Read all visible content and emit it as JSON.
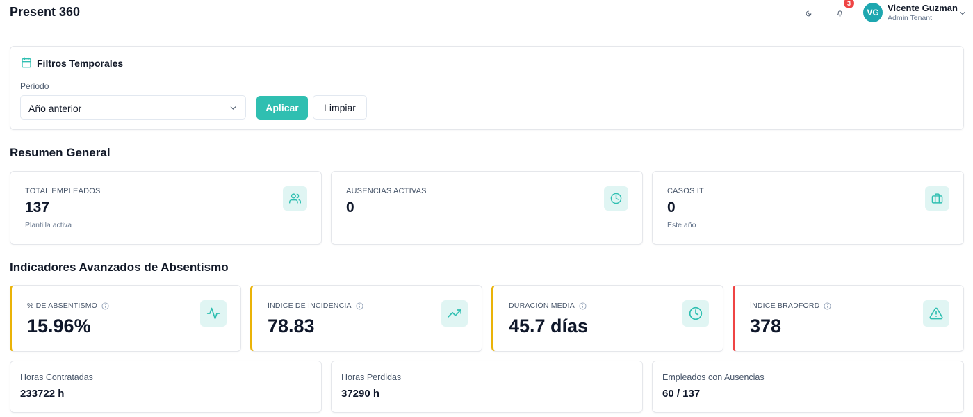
{
  "header": {
    "app_title": "Present 360",
    "notification_count": "3",
    "user": {
      "initials": "VG",
      "name": "Vicente Guzman",
      "role": "Admin Tenant"
    }
  },
  "filters": {
    "title": "Filtros Temporales",
    "period_label": "Periodo",
    "period_value": "Año anterior",
    "apply_label": "Aplicar",
    "clear_label": "Limpiar"
  },
  "summary": {
    "title": "Resumen General",
    "cards": [
      {
        "label": "TOTAL EMPLEADOS",
        "value": "137",
        "sub": "Plantilla activa",
        "icon": "users-icon"
      },
      {
        "label": "AUSENCIAS ACTIVAS",
        "value": "0",
        "sub": "",
        "icon": "clock-icon"
      },
      {
        "label": "CASOS IT",
        "value": "0",
        "sub": "Este año",
        "icon": "briefcase-icon"
      }
    ]
  },
  "indicators": {
    "title": "Indicadores Avanzados de Absentismo",
    "cards": [
      {
        "label": "% DE ABSENTISMO",
        "value": "15.96%",
        "icon": "activity-icon",
        "accent": "#eab308"
      },
      {
        "label": "ÍNDICE DE INCIDENCIA",
        "value": "78.83",
        "icon": "trending-up-icon",
        "accent": "#eab308"
      },
      {
        "label": "DURACIÓN MEDIA",
        "value": "45.7 días",
        "icon": "clock-icon",
        "accent": "#eab308"
      },
      {
        "label": "ÍNDICE BRADFORD",
        "value": "378",
        "icon": "alert-triangle-icon",
        "accent": "#ef4444"
      }
    ]
  },
  "hours": [
    {
      "label": "Horas Contratadas",
      "value": "233722 h"
    },
    {
      "label": "Horas Perdidas",
      "value": "37290 h"
    },
    {
      "label": "Empleados con Ausencias",
      "value": "60 / 137"
    }
  ],
  "colors": {
    "accent": "#2fbfb1",
    "icon_bg": "#e0f5f3",
    "warning": "#eab308",
    "danger": "#ef4444"
  }
}
